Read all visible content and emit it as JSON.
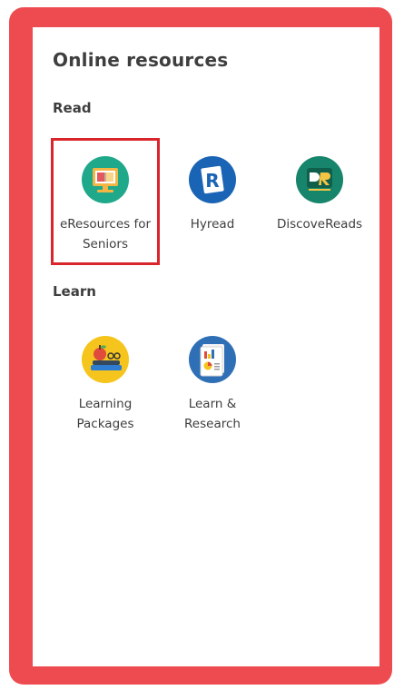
{
  "page": {
    "title": "Online resources"
  },
  "sections": {
    "read": {
      "title": "Read",
      "items": [
        {
          "label": "eResources for Seniors",
          "icon": "monitor-book-icon"
        },
        {
          "label": "Hyread",
          "icon": "hyread-logo-icon"
        },
        {
          "label": "DiscoveReads",
          "icon": "discovereads-logo-icon"
        }
      ]
    },
    "learn": {
      "title": "Learn",
      "items": [
        {
          "label": "Learning Packages",
          "icon": "books-apple-icon"
        },
        {
          "label": "Learn & Research",
          "icon": "research-document-icon"
        }
      ]
    }
  },
  "colors": {
    "frame": "#ee4b50",
    "highlight": "#d9262d",
    "text": "#3e3e3e"
  }
}
